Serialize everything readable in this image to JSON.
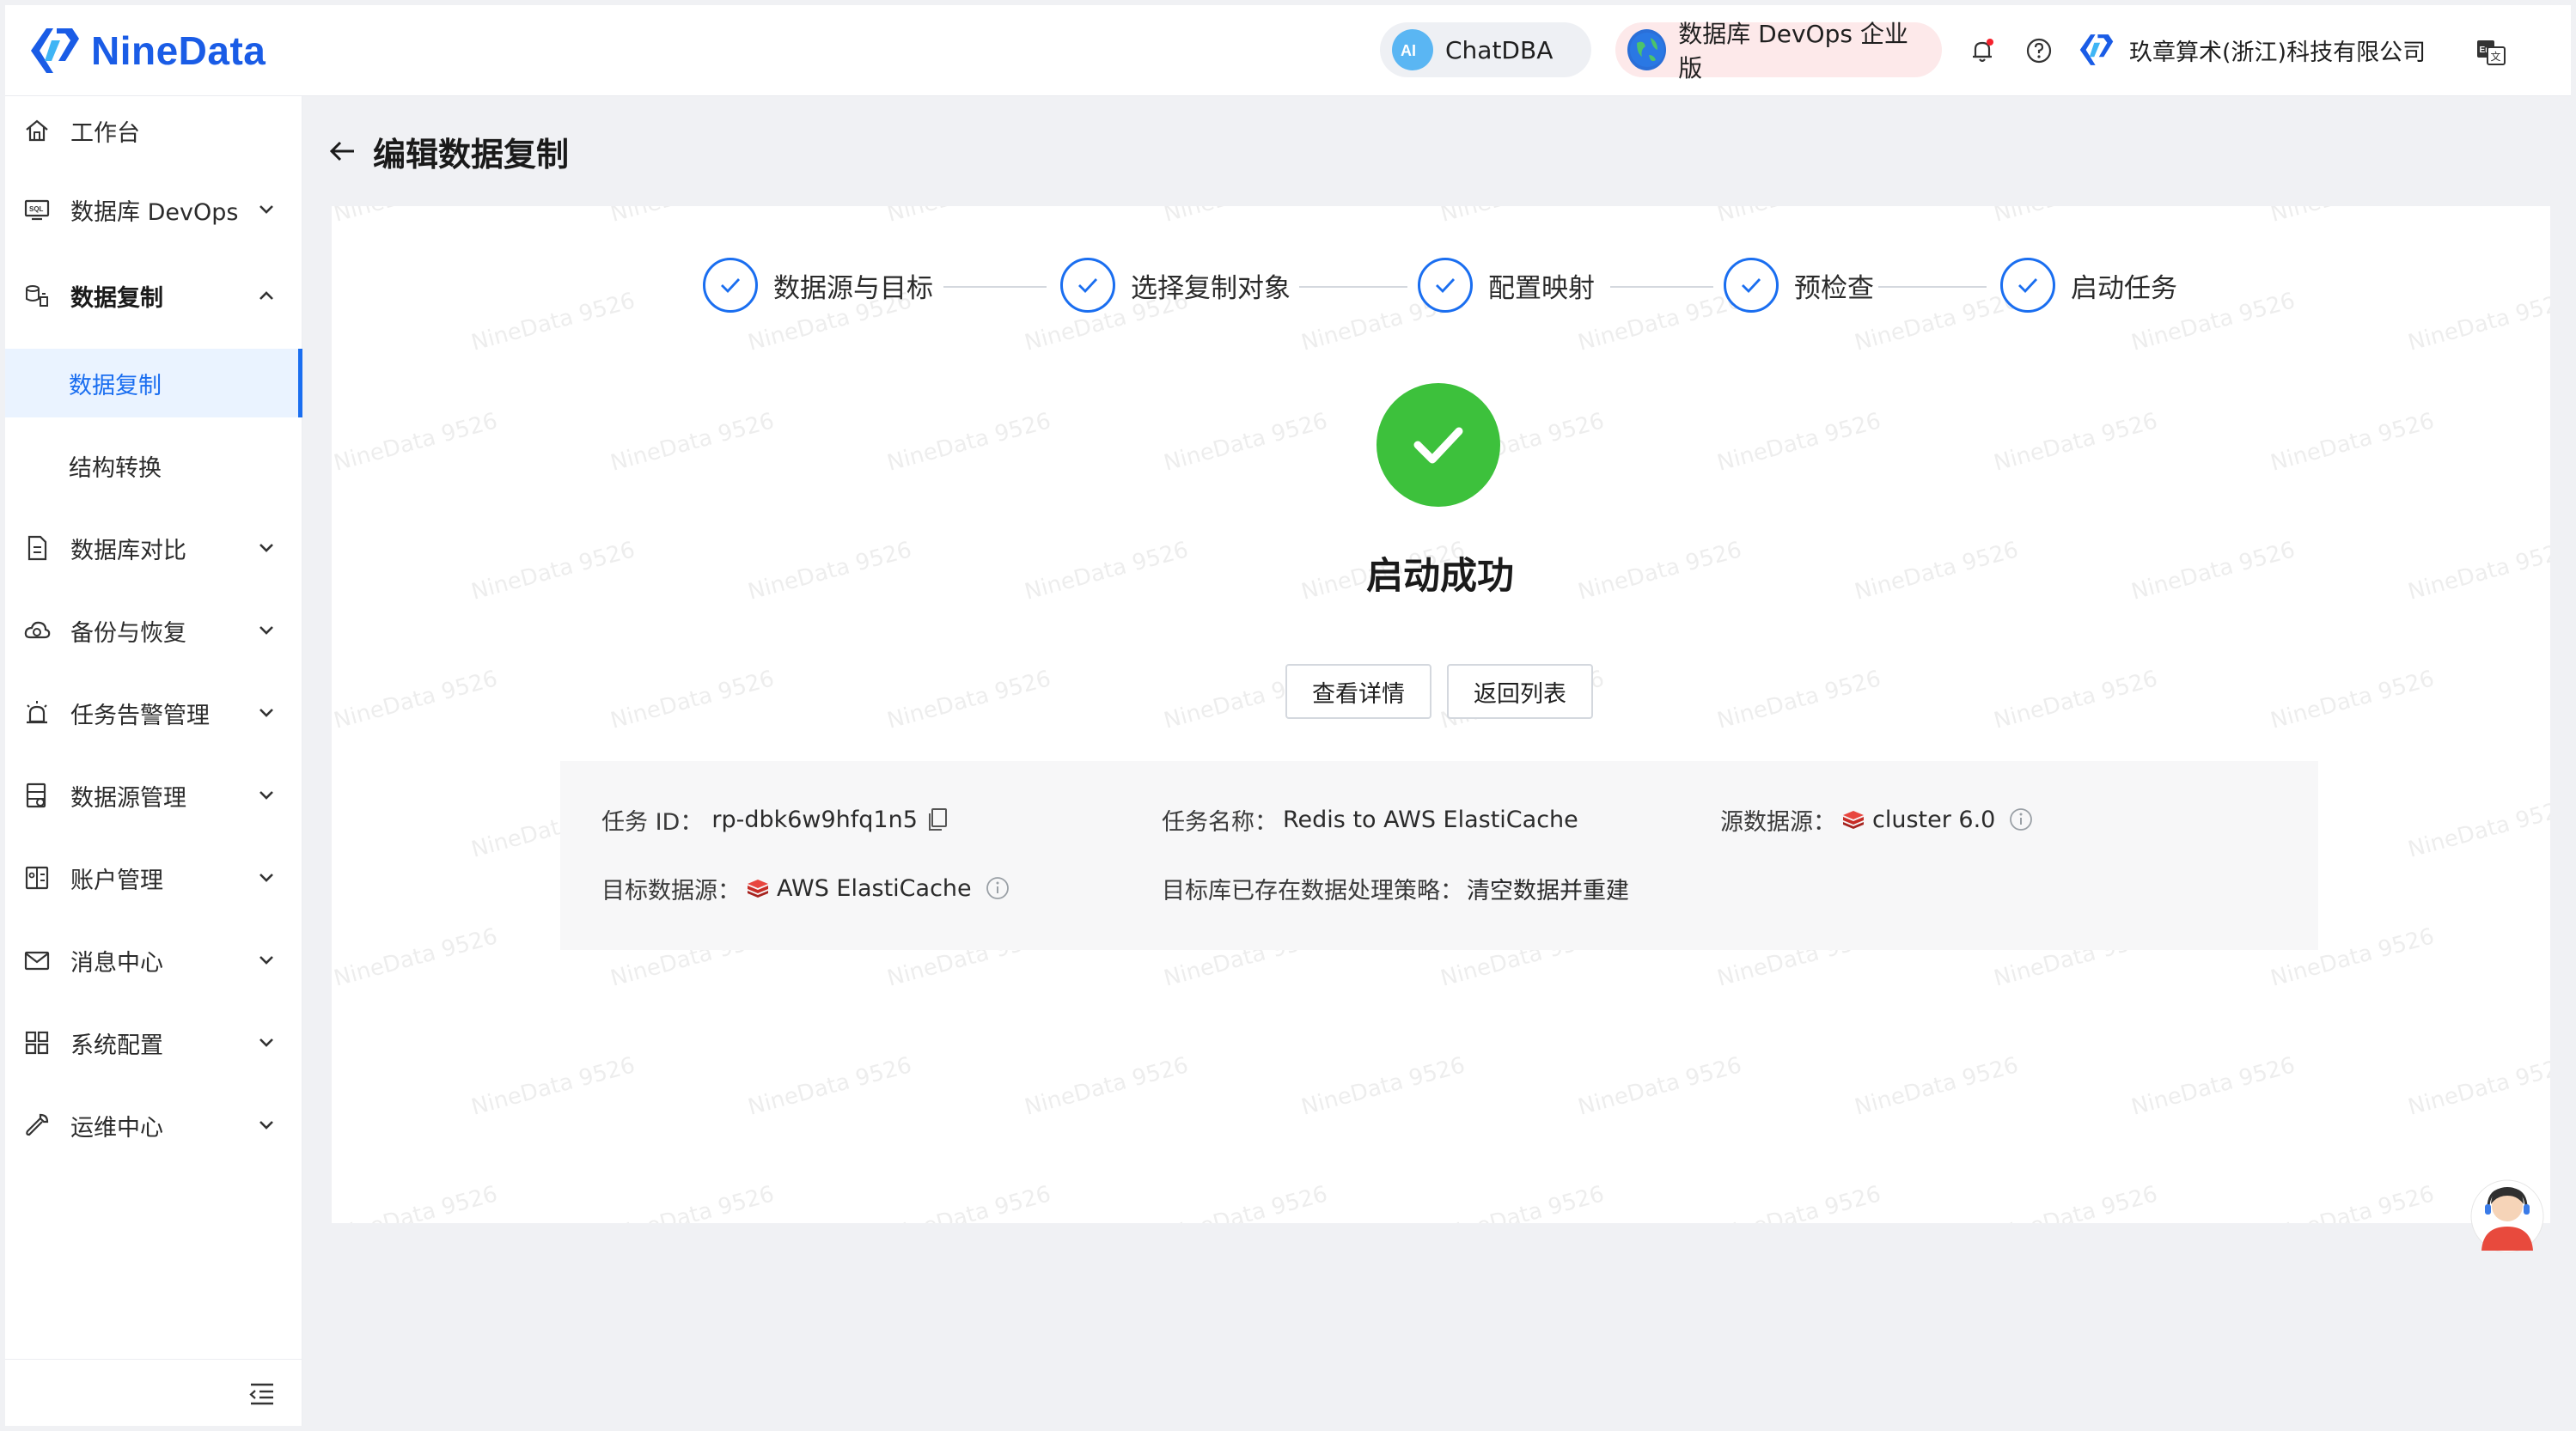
{
  "header": {
    "brand": "NineData",
    "chatdba_label": "ChatDBA",
    "devops_label": "数据库 DevOps 企业版",
    "company": "玖章算术(浙江)科技有限公司"
  },
  "sidebar": {
    "items": [
      {
        "label": "工作台",
        "icon": "home-icon"
      },
      {
        "label": "数据库 DevOps",
        "icon": "sql-monitor-icon"
      },
      {
        "label": "数据复制",
        "icon": "replication-icon"
      },
      {
        "label": "数据复制",
        "icon": ""
      },
      {
        "label": "结构转换",
        "icon": ""
      },
      {
        "label": "数据库对比",
        "icon": "compare-doc-icon"
      },
      {
        "label": "备份与恢复",
        "icon": "cloud-backup-icon"
      },
      {
        "label": "任务告警管理",
        "icon": "alarm-icon"
      },
      {
        "label": "数据源管理",
        "icon": "datasource-icon"
      },
      {
        "label": "账户管理",
        "icon": "account-icon"
      },
      {
        "label": "消息中心",
        "icon": "mail-icon"
      },
      {
        "label": "系统配置",
        "icon": "grid-icon"
      },
      {
        "label": "运维中心",
        "icon": "wrench-icon"
      }
    ]
  },
  "page": {
    "title": "编辑数据复制"
  },
  "steps": [
    {
      "label": "数据源与目标"
    },
    {
      "label": "选择复制对象"
    },
    {
      "label": "配置映射"
    },
    {
      "label": "预检查"
    },
    {
      "label": "启动任务"
    }
  ],
  "result": {
    "title": "启动成功",
    "detail_button": "查看详情",
    "back_button": "返回列表"
  },
  "info": {
    "task_id_label": "任务 ID：",
    "task_id": "rp-dbk6w9hfq1n5",
    "task_name_label": "任务名称：",
    "task_name": "Redis to AWS ElastiCache",
    "source_label": "源数据源：",
    "source": "cluster 6.0",
    "target_label": "目标数据源：",
    "target": "AWS ElastiCache",
    "strategy_label": "目标库已存在数据处理策略：",
    "strategy": "清空数据并重建"
  },
  "watermark": "NineData 9526",
  "colors": {
    "brand": "#1a5ce6",
    "accent": "#1a6ef0",
    "success": "#3dc13c",
    "redis": "#d8322c"
  }
}
